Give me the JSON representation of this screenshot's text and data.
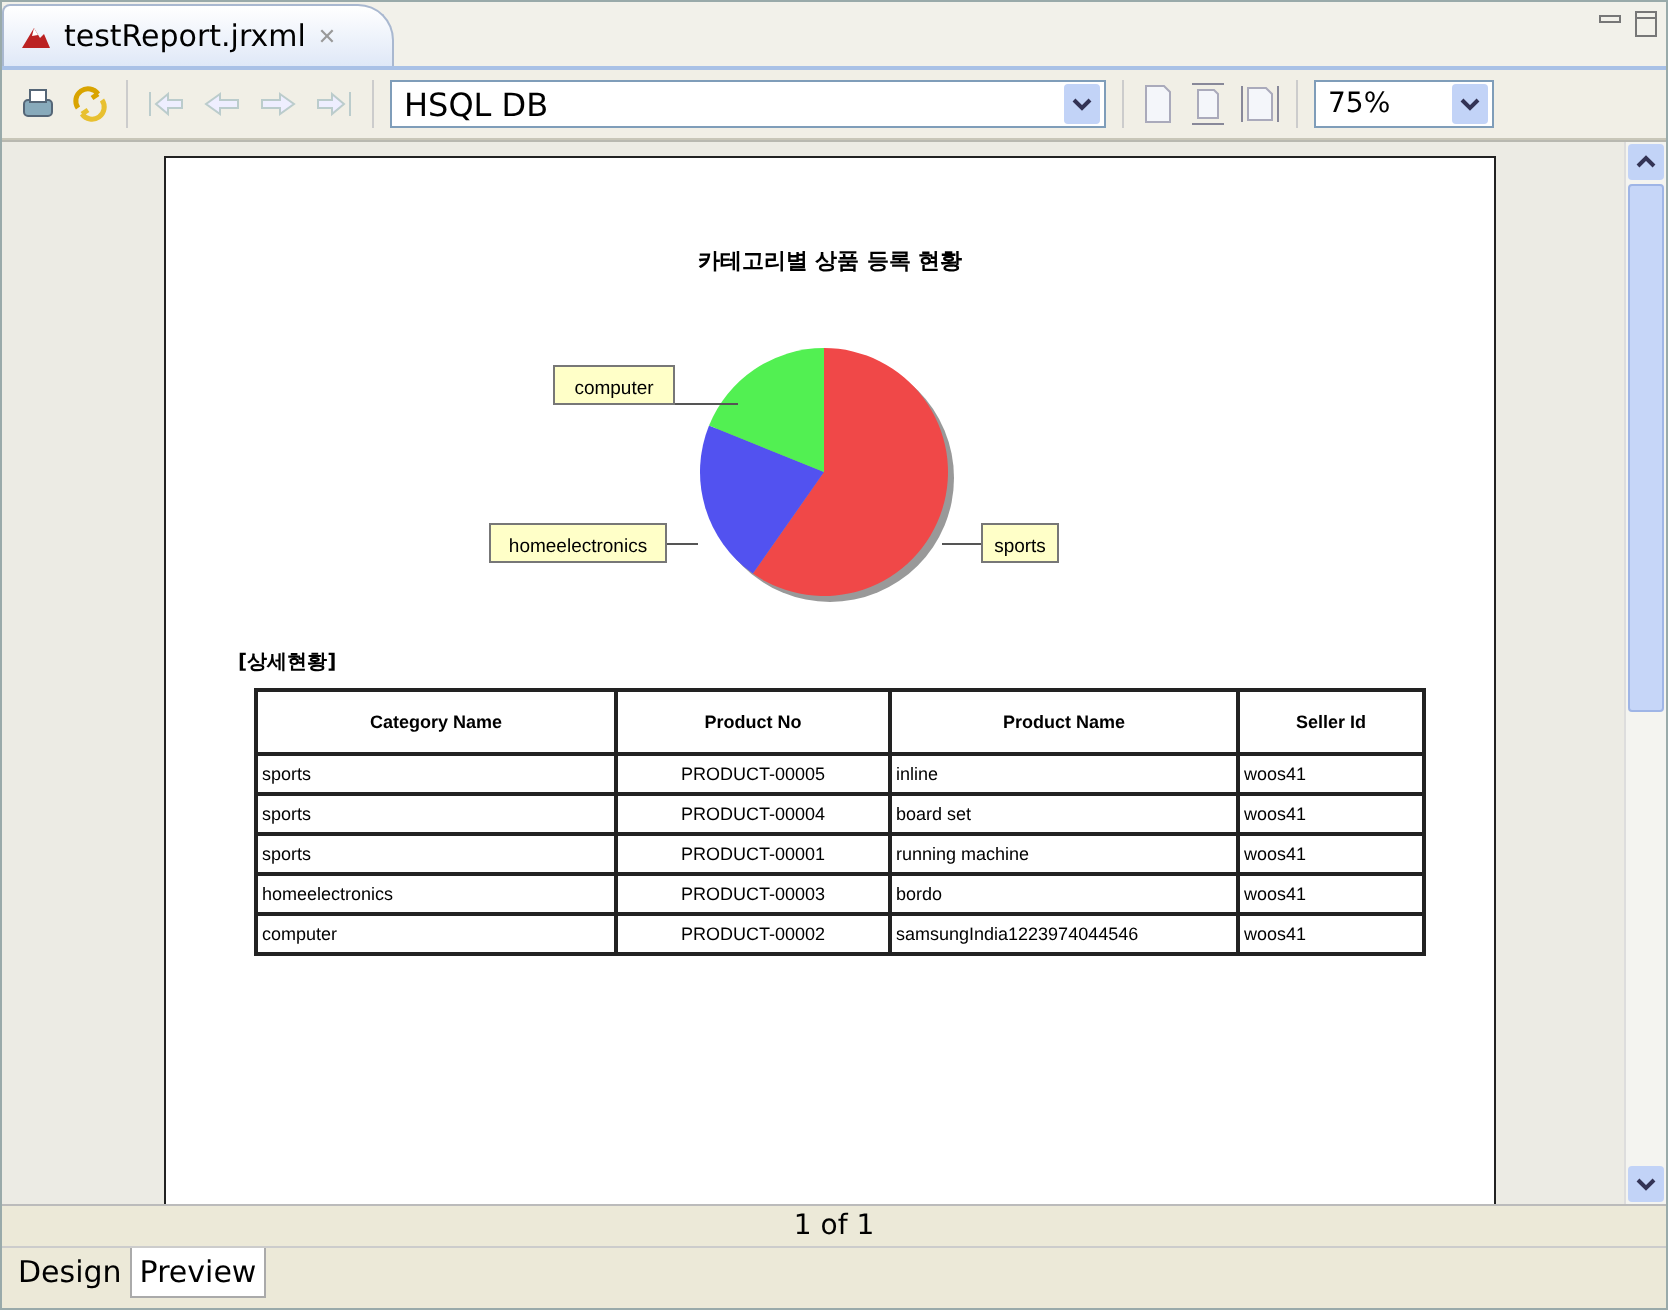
{
  "editor_tab": {
    "title": "testReport.jrxml",
    "close": "✕"
  },
  "toolbar": {
    "datasource": "HSQL DB",
    "zoom": "75%"
  },
  "report": {
    "chart_title": "카테고리별 상품 등록 현황",
    "slices": [
      {
        "label": "sports",
        "color": "#f04848"
      },
      {
        "label": "homeelectronics",
        "color": "#5252f0"
      },
      {
        "label": "computer",
        "color": "#52f052"
      }
    ],
    "section_label": "[상세현황]",
    "table": {
      "columns": [
        "Category Name",
        "Product No",
        "Product Name",
        "Seller Id"
      ],
      "rows": [
        [
          "sports",
          "PRODUCT-00005",
          "inline",
          "woos41"
        ],
        [
          "sports",
          "PRODUCT-00004",
          "board set",
          "woos41"
        ],
        [
          "sports",
          "PRODUCT-00001",
          "running machine",
          "woos41"
        ],
        [
          "homeelectronics",
          "PRODUCT-00003",
          "bordo",
          "woos41"
        ],
        [
          "computer",
          "PRODUCT-00002",
          "samsungIndia1223974044546",
          "woos41"
        ]
      ]
    }
  },
  "status": "1 of 1",
  "bottom_tabs": [
    {
      "label": "Design",
      "selected": false
    },
    {
      "label": "Preview",
      "selected": true
    }
  ]
}
